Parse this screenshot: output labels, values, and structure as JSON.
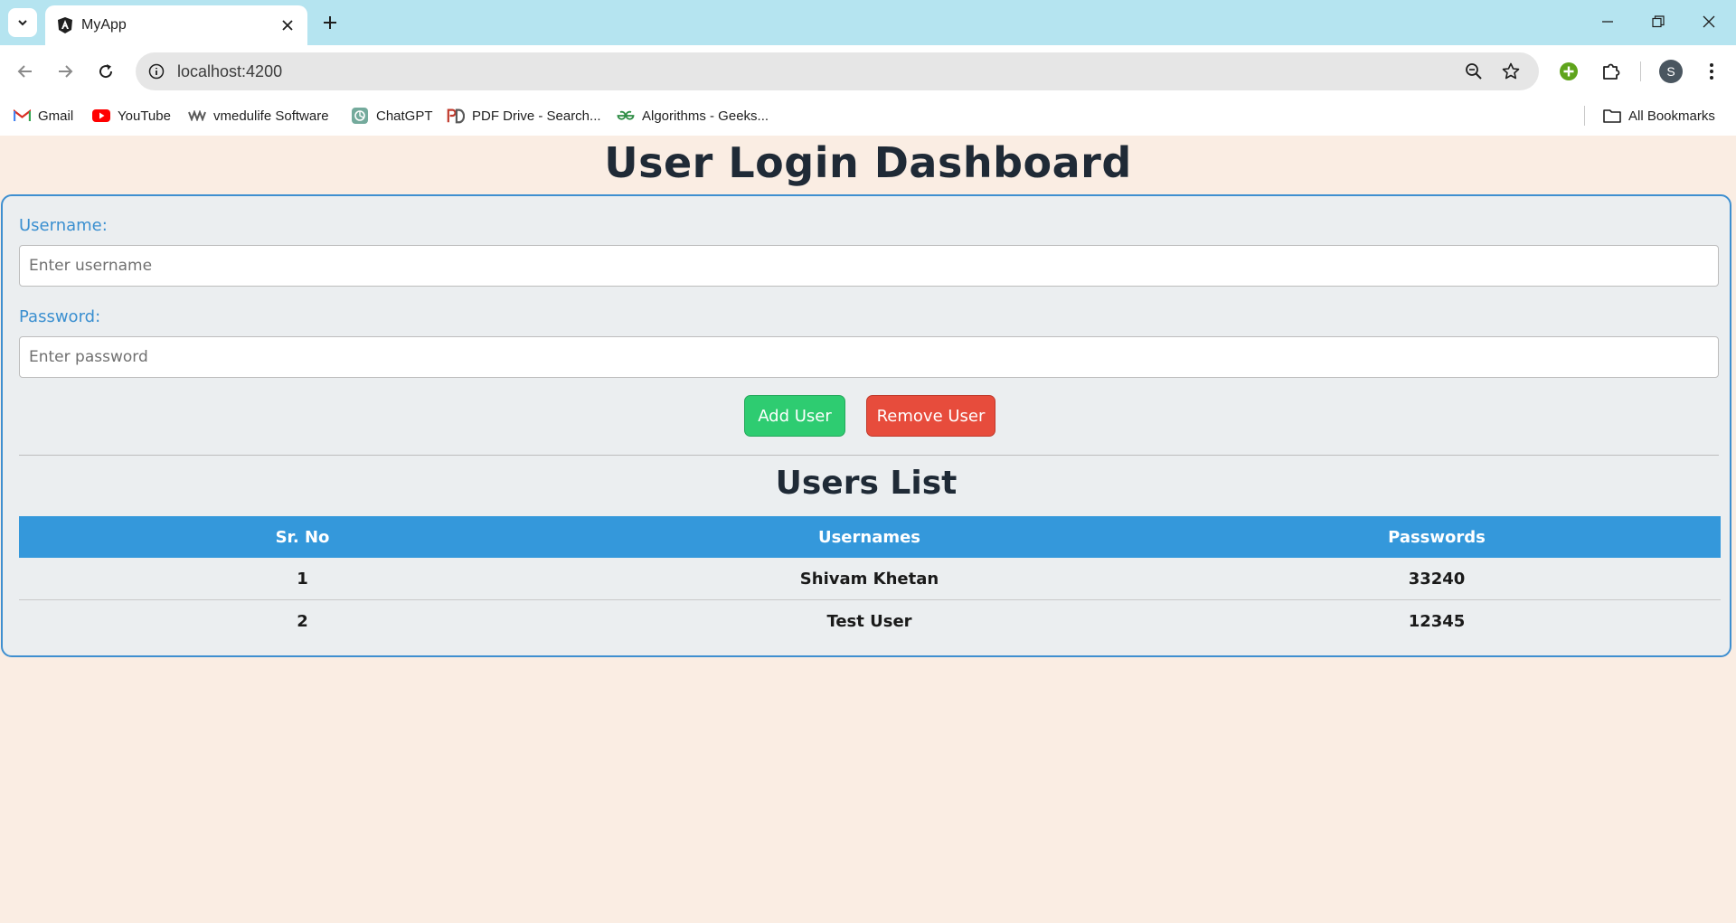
{
  "browser": {
    "tab": {
      "title": "MyApp"
    },
    "address": {
      "url": "localhost:4200"
    },
    "profile_initial": "S",
    "bookmarks": [
      {
        "label": "Gmail",
        "icon": "gmail-icon"
      },
      {
        "label": "YouTube",
        "icon": "youtube-icon"
      },
      {
        "label": "vmedulife Software",
        "icon": "vmedulife-icon"
      },
      {
        "label": "ChatGPT",
        "icon": "chatgpt-icon"
      },
      {
        "label": "PDF Drive - Search...",
        "icon": "pdf-drive-icon"
      },
      {
        "label": "Algorithms - Geeks...",
        "icon": "geeksforgeeks-icon"
      }
    ],
    "all_bookmarks_label": "All Bookmarks"
  },
  "page": {
    "title": "User Login Dashboard",
    "form": {
      "username_label": "Username:",
      "username_placeholder": "Enter username",
      "username_value": "",
      "password_label": "Password:",
      "password_placeholder": "Enter password",
      "password_value": "",
      "add_button": "Add User",
      "remove_button": "Remove User"
    },
    "users_list": {
      "title": "Users List",
      "headers": [
        "Sr. No",
        "Usernames",
        "Passwords"
      ],
      "rows": [
        [
          "1",
          "Shivam Khetan",
          "33240"
        ],
        [
          "2",
          "Test User",
          "12345"
        ]
      ]
    }
  },
  "colors": {
    "page_background": "#faede3",
    "card_border": "#3e8fd0",
    "label": "#3a8fd0",
    "table_header": "#3498db",
    "add_button": "#2ecc71",
    "remove_button": "#e74c3c",
    "tabstrip": "#b5e4f0"
  }
}
